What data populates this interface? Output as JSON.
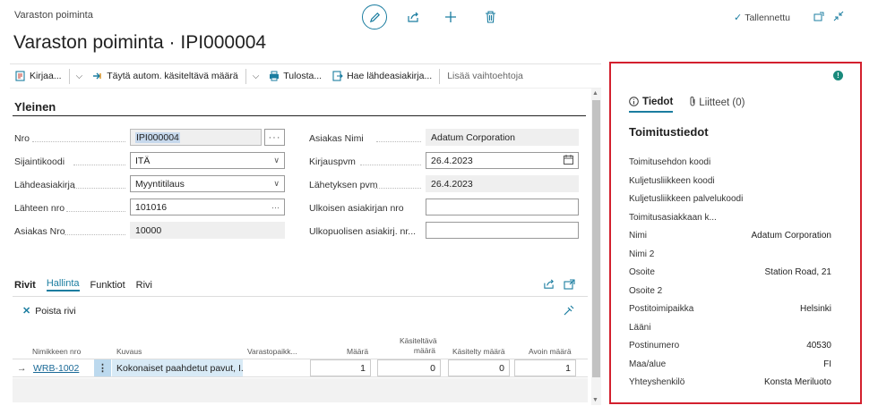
{
  "header": {
    "breadcrumb": "Varaston poiminta",
    "title": "Varaston poiminta · IPI000004",
    "saved_label": "Tallennettu",
    "accent": "#1b7da0"
  },
  "actions": {
    "post": "Kirjaa...",
    "autofill": "Täytä autom. käsiteltävä määrä",
    "print": "Tulosta...",
    "get_source": "Hae lähdeasiakirja...",
    "more": "Lisää vaihtoehtoja"
  },
  "general": {
    "section_title": "Yleinen",
    "no_label": "Nro",
    "no_value": "IPI000004",
    "location_label": "Sijaintikoodi",
    "location_value": "ITÄ",
    "source_doc_label": "Lähdeasiakirja",
    "source_doc_value": "Myyntitilaus",
    "source_no_label": "Lähteen nro",
    "source_no_value": "101016",
    "customer_no_label": "Asiakas Nro",
    "customer_no_value": "10000",
    "customer_name_label": "Asiakas Nimi",
    "customer_name_value": "Adatum Corporation",
    "posting_date_label": "Kirjauspvm",
    "posting_date_value": "26.4.2023",
    "shipment_date_label": "Lähetyksen pvm",
    "shipment_date_value": "26.4.2023",
    "ext_doc_label": "Ulkoisen asiakirjan nro",
    "ext_doc_value": "",
    "outside_doc_label": "Ulkopuolisen asiakirj. nr...",
    "outside_doc_value": ""
  },
  "lines": {
    "title": "Rivit",
    "tabs": [
      "Hallinta",
      "Funktiot",
      "Rivi"
    ],
    "delete_label": "Poista rivi",
    "columns": {
      "item_no": "Nimikkeen nro",
      "description": "Kuvaus",
      "bin": "Varastopaikk...",
      "quantity": "Määrä",
      "to_handle_1": "Käsiteltävä",
      "to_handle_2": "määrä",
      "handled": "Käsitelty määrä",
      "outstanding": "Avoin määrä"
    },
    "row": {
      "item_no": "WRB-1002",
      "description": "Kokonaiset paahdetut pavut, I...",
      "bin": "",
      "quantity": "1",
      "to_handle": "0",
      "handled": "0",
      "outstanding": "1"
    }
  },
  "factbox": {
    "tab_details": "Tiedot",
    "tab_attachments": "Liitteet (0)",
    "heading": "Toimitustiedot",
    "rows": [
      {
        "label": "Toimitusehdon koodi",
        "value": ""
      },
      {
        "label": "Kuljetusliikkeen koodi",
        "value": ""
      },
      {
        "label": "Kuljetusliikkeen palvelukoodi",
        "value": ""
      },
      {
        "label": "Toimitusasiakkaan k...",
        "value": ""
      },
      {
        "label": "Nimi",
        "value": "Adatum Corporation"
      },
      {
        "label": "Nimi 2",
        "value": ""
      },
      {
        "label": "Osoite",
        "value": "Station Road, 21"
      },
      {
        "label": "Osoite 2",
        "value": ""
      },
      {
        "label": "Postitoimipaikka",
        "value": "Helsinki"
      },
      {
        "label": "Lääni",
        "value": ""
      },
      {
        "label": "Postinumero",
        "value": "40530"
      },
      {
        "label": "Maa/alue",
        "value": "FI"
      },
      {
        "label": "Yhteyshenkilö",
        "value": "Konsta Meriluoto"
      }
    ],
    "border_color": "#d3202e"
  }
}
